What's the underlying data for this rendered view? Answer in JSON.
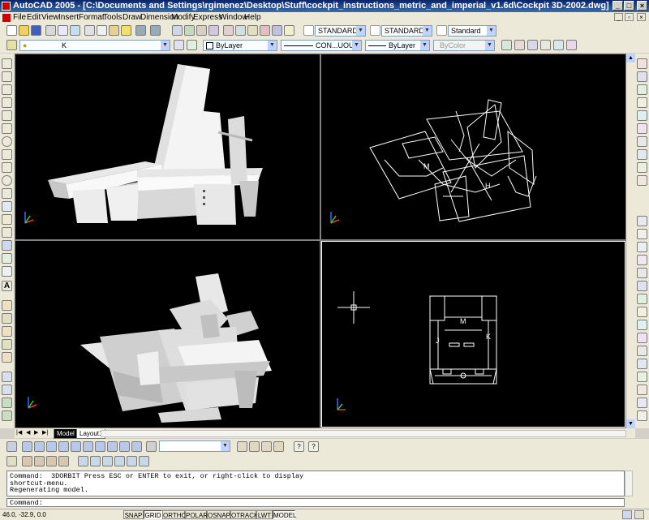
{
  "window": {
    "title": "AutoCAD 2005 - [C:\\Documents and Settings\\rgimenez\\Desktop\\Stuff\\cockpit_instructions_metric_and_imperial_v1.6d\\Cockpit 3D-2002.dwg]",
    "controls": [
      "_",
      "□",
      "×"
    ]
  },
  "menu": {
    "items": [
      "File",
      "Edit",
      "View",
      "Insert",
      "Format",
      "Tools",
      "Draw",
      "Dimension",
      "Modify",
      "Express",
      "Window",
      "Help"
    ]
  },
  "styles_toolbar": {
    "text_style": "STANDARD",
    "dim_style": "STANDARD",
    "table_style": "Standard"
  },
  "layers_toolbar": {
    "layer": "K",
    "color": "ByLayer",
    "linetype": "CON...UOUS",
    "lineweight": "ByLayer",
    "plotstyle": "ByColor"
  },
  "viewports": {
    "top_right_labels": [
      "M",
      "H"
    ],
    "bottom_right_labels": [
      "M",
      "J",
      "K"
    ]
  },
  "layout_tabs": [
    "Model",
    "Layout1"
  ],
  "command": {
    "history": [
      "Command:  3DORBIT Press ESC or ENTER to exit, or right-click to display",
      "shortcut-menu.",
      "Regenerating model."
    ],
    "prompt": "Command:"
  },
  "status": {
    "coordinates": "46.0, -32.9, 0.0",
    "toggles": [
      {
        "label": "SNAP",
        "on": false
      },
      {
        "label": "GRID",
        "on": true
      },
      {
        "label": "ORTHO",
        "on": false
      },
      {
        "label": "POLAR",
        "on": false
      },
      {
        "label": "OSNAP",
        "on": false
      },
      {
        "label": "OTRACK",
        "on": false
      },
      {
        "label": "LWT",
        "on": false
      },
      {
        "label": "MODEL",
        "on": true
      }
    ]
  },
  "colors": {
    "titlebar": "#0a246a",
    "viewport_bg": "#000000",
    "wire": "#ffffff",
    "ucs_x": "#ff3030",
    "ucs_y": "#30d030",
    "ucs_z": "#3070ff"
  }
}
